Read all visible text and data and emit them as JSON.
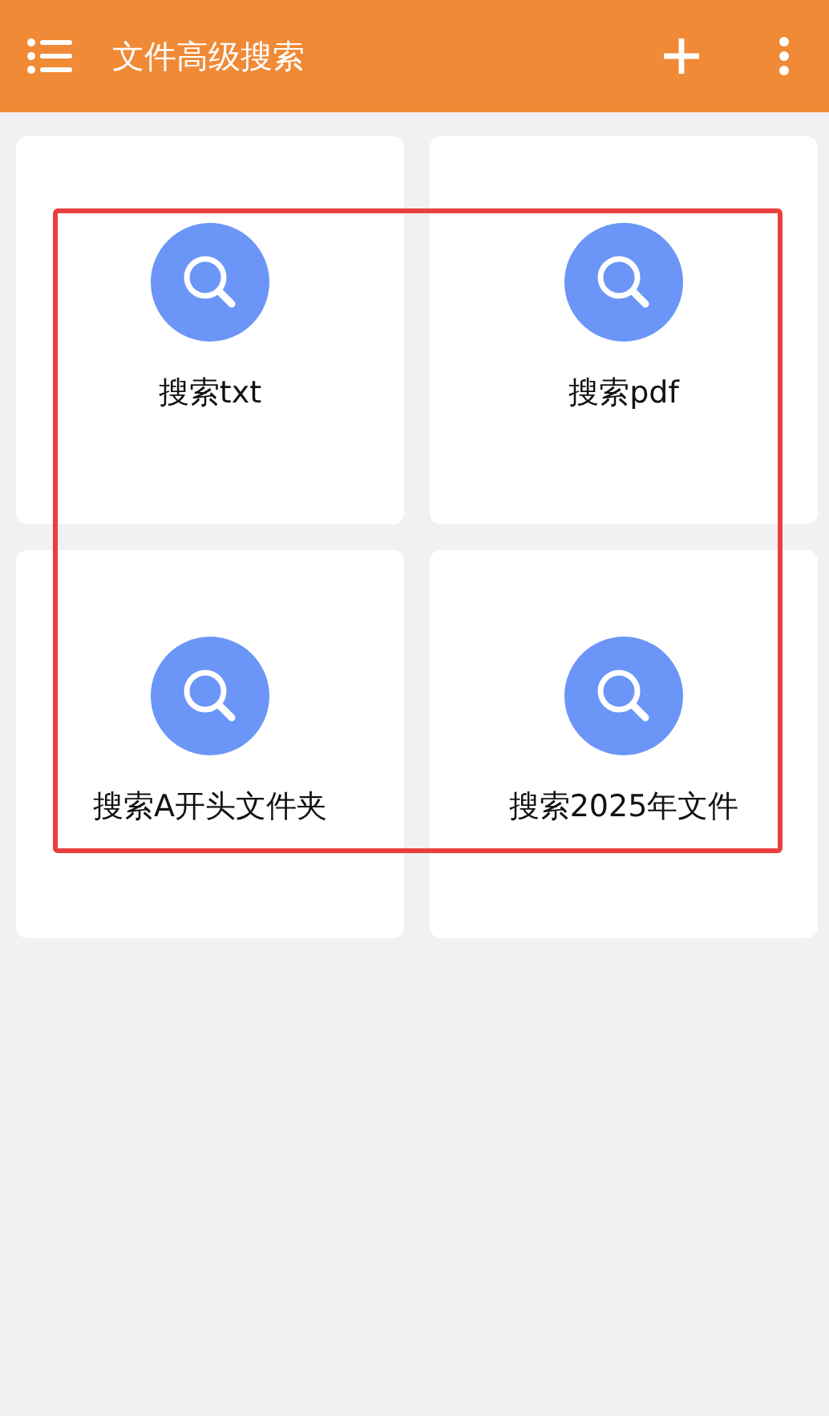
{
  "app_bar": {
    "title": "文件高级搜索"
  },
  "cards": [
    {
      "label": "搜索txt"
    },
    {
      "label": "搜索pdf"
    },
    {
      "label": "搜索A开头文件夹"
    },
    {
      "label": "搜索2025年文件"
    }
  ],
  "annotation": {
    "kind": "rectangle",
    "color": "#e8403f"
  }
}
